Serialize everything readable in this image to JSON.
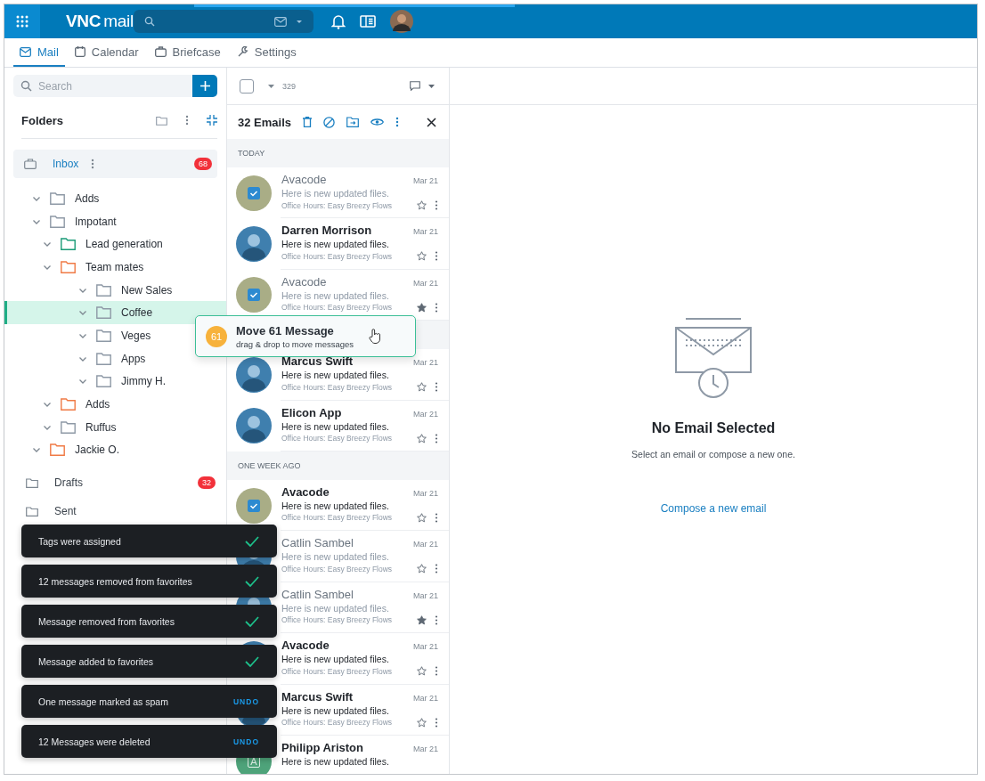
{
  "topbar": {
    "logo_bold": "VNC",
    "logo_light": "mail"
  },
  "tabs": [
    {
      "label": "Mail",
      "selected": true
    },
    {
      "label": "Calendar",
      "selected": false
    },
    {
      "label": "Briefcase",
      "selected": false
    },
    {
      "label": "Settings",
      "selected": false
    }
  ],
  "sidebar": {
    "search": {
      "placeholder": "Search"
    },
    "folders_title": "Folders",
    "mailboxes": [
      {
        "label": "Inbox",
        "selected": true,
        "count": "68",
        "children": [
          {
            "label": "Adds",
            "expanded": true,
            "selected": false,
            "color": "#8e99a6"
          },
          {
            "label": "Impotant",
            "expanded": true,
            "selected": false,
            "color": "#8e99a6",
            "children": [
              {
                "label": "Lead generation",
                "expanded": true,
                "selected": false,
                "color": "#1a9b77"
              },
              {
                "label": "Team mates",
                "expanded": true,
                "selected": false,
                "color": "#f07a45",
                "children": [
                  {
                    "label": "New Sales",
                    "expanded": true,
                    "selected": false,
                    "color": "#8e99a6"
                  },
                  {
                    "label": "Coffee",
                    "expanded": true,
                    "selected": true,
                    "color": "#8e99a6"
                  },
                  {
                    "label": "Veges",
                    "expanded": true,
                    "selected": false,
                    "color": "#8e99a6"
                  },
                  {
                    "label": "Apps",
                    "expanded": true,
                    "selected": false,
                    "color": "#8e99a6"
                  },
                  {
                    "label": "Jimmy H.",
                    "expanded": true,
                    "selected": false,
                    "color": "#8e99a6"
                  }
                ]
              },
              {
                "label": "Adds",
                "expanded": true,
                "selected": false,
                "color": "#f07a45"
              },
              {
                "label": "Ruffus",
                "expanded": true,
                "selected": false,
                "color": "#8e99a6"
              }
            ]
          },
          {
            "label": "Jackie O.",
            "expanded": true,
            "selected": false,
            "color": "#f07a45"
          }
        ]
      },
      {
        "label": "Drafts",
        "selected": false,
        "count": "32"
      },
      {
        "label": "Sent",
        "selected": false
      }
    ]
  },
  "list": {
    "select_all": {
      "checked": false
    },
    "count": "329",
    "selection_title": "32 Emails",
    "sections": [
      {
        "label": "TODAY",
        "emails": [
          {
            "sender": "Avacode",
            "preview": "Here is new updated files.",
            "subject": "Office Hours: Easy Breezy Flows",
            "date": "Mar 21",
            "read": true,
            "starred": false,
            "kind": "checked"
          },
          {
            "sender": "Darren Morrison",
            "preview": "Here is new updated files.",
            "subject": "Office Hours: Easy Breezy Flows",
            "date": "Mar 21",
            "read": false,
            "starred": false,
            "kind": "photo"
          },
          {
            "sender": "Avacode",
            "preview": "Here is new updated files.",
            "subject": "Office Hours: Easy Breezy Flows",
            "date": "Mar 21",
            "read": true,
            "starred": true,
            "kind": "checked"
          }
        ]
      },
      {
        "emails": [
          {
            "sender": "Marcus Swift",
            "preview": "Here is new updated files.",
            "subject": "Office Hours: Easy Breezy Flows",
            "date": "Mar 21",
            "read": false,
            "starred": false,
            "kind": "photo"
          },
          {
            "sender": "Elicon App",
            "preview": "Here is new updated files.",
            "subject": "Office Hours: Easy Breezy Flows",
            "date": "Mar 21",
            "read": false,
            "starred": false,
            "kind": "photo"
          }
        ]
      },
      {
        "label": "ONE WEEK AGO",
        "emails": [
          {
            "sender": "Avacode",
            "preview": "Here is new updated files.",
            "subject": "Office Hours: Easy Breezy Flows",
            "date": "Mar 21",
            "read": false,
            "starred": false,
            "kind": "checked"
          },
          {
            "sender": "Catlin Sambel",
            "preview": "Here is new updated files.",
            "subject": "Office Hours: Easy Breezy Flows",
            "date": "Mar 21",
            "read": true,
            "starred": false,
            "kind": "photo"
          },
          {
            "sender": "Catlin Sambel",
            "preview": "Here is new updated files.",
            "subject": "Office Hours: Easy Breezy Flows",
            "date": "Mar 21",
            "read": true,
            "starred": true,
            "kind": "photo"
          },
          {
            "sender": "Avacode",
            "preview": "Here is new updated files.",
            "subject": "Office Hours: Easy Breezy Flows",
            "date": "Mar 21",
            "read": false,
            "starred": false,
            "kind": "photo"
          },
          {
            "sender": "Marcus Swift",
            "preview": "Here is new updated files.",
            "subject": "Office Hours: Easy Breezy Flows",
            "date": "Mar 21",
            "read": false,
            "starred": false,
            "kind": "photo"
          },
          {
            "sender": "Philipp Ariston",
            "preview": "Here is new updated files.",
            "date": "Mar 21",
            "read": false,
            "kind": "initial",
            "initial": "A"
          }
        ]
      }
    ]
  },
  "drag": {
    "count": "61",
    "title": "Move 61 Message",
    "hint": "drag & drop to move messages"
  },
  "reader": {
    "title": "No Email Selected",
    "subtitle": "Select an email or compose a new one.",
    "link": "Compose a new email"
  },
  "toasts": [
    {
      "text": "Tags were assigned",
      "kind": "done"
    },
    {
      "text": "12 messages removed from favorites",
      "kind": "done"
    },
    {
      "text": "Message removed from favorites",
      "kind": "done"
    },
    {
      "text": "Message added to favorites",
      "kind": "done"
    },
    {
      "text": "One message marked as spam",
      "kind": "undo",
      "action": "UNDO"
    },
    {
      "text": "12 Messages were deleted",
      "kind": "undo",
      "action": "UNDO"
    }
  ]
}
